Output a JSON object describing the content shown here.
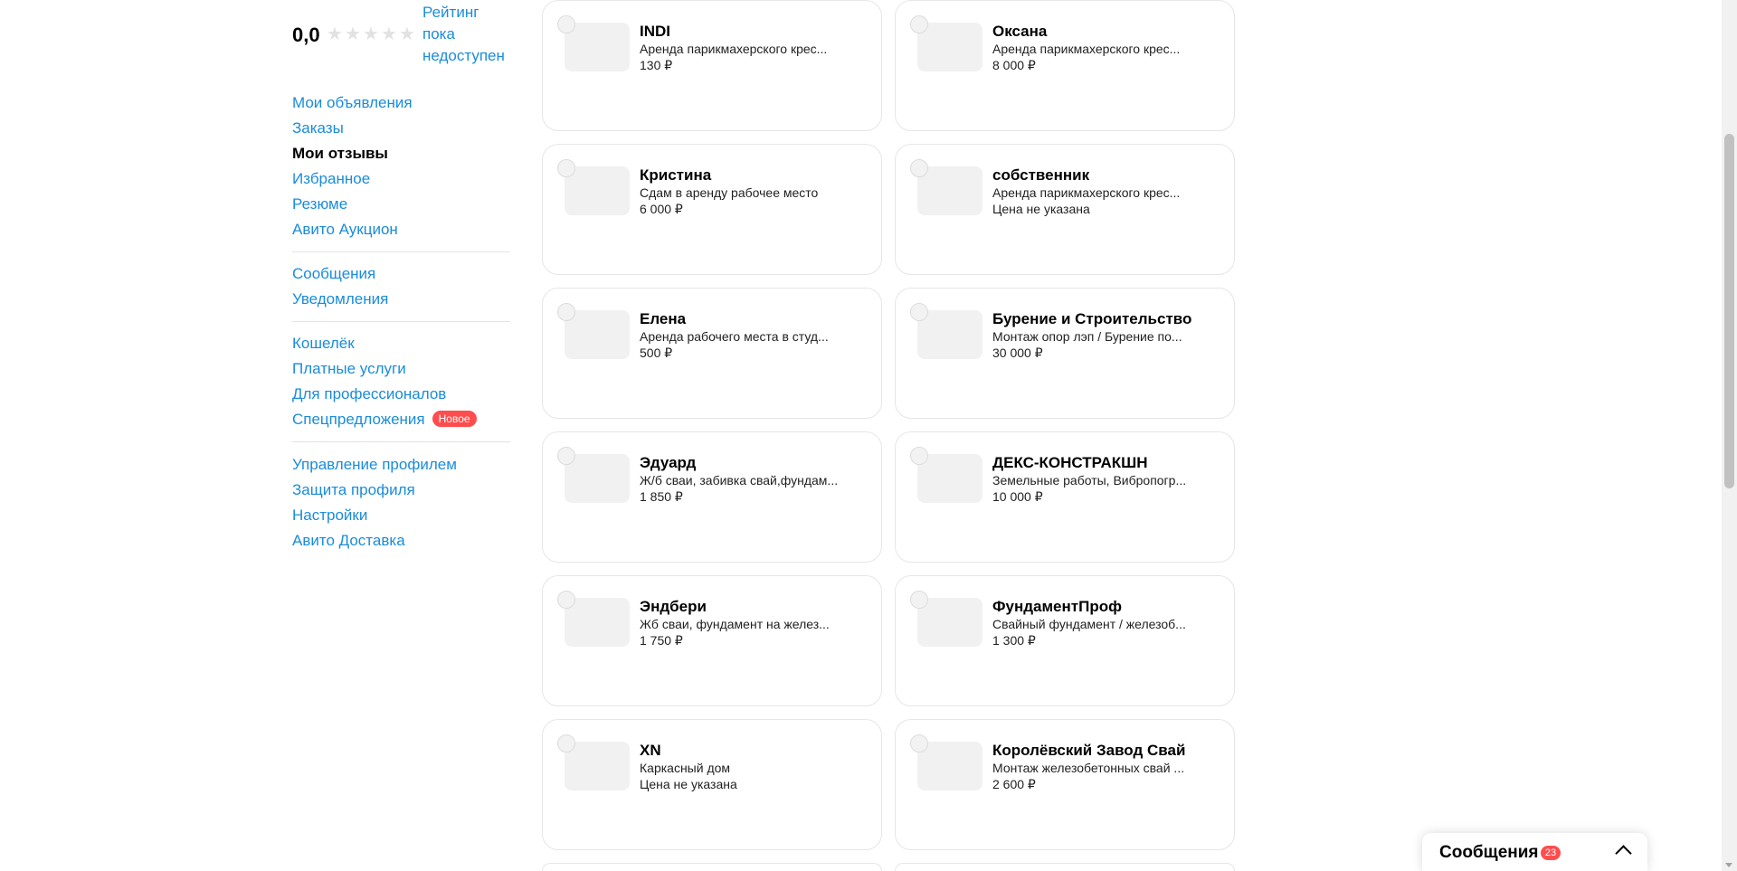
{
  "rating": {
    "value": "0,0",
    "note": "Рейтинг пока недоступен",
    "stars_filled": 0,
    "stars_total": 5
  },
  "sidebar": {
    "group1": [
      "Мои объявления",
      "Заказы",
      "Мои отзывы",
      "Избранное",
      "Резюме",
      "Авито Аукцион"
    ],
    "group2": [
      "Сообщения",
      "Уведомления"
    ],
    "group3": [
      "Кошелёк",
      "Платные услуги",
      "Для профессионалов",
      "Спецпредложения"
    ],
    "new_badge": "Новое",
    "group4": [
      "Управление профилем",
      "Защита профиля",
      "Настройки",
      "Авито Доставка"
    ],
    "active_item": "Мои отзывы"
  },
  "cards": [
    {
      "name": "INDI",
      "desc": "Аренда парикмахерского крес...",
      "price": "130 ₽"
    },
    {
      "name": "Оксана",
      "desc": "Аренда парикмахерского крес...",
      "price": "8 000 ₽"
    },
    {
      "name": "Кристина",
      "desc": "Сдам в аренду рабочее место",
      "price": "6 000 ₽"
    },
    {
      "name": "собственник",
      "desc": "Аренда парикмахерского крес...",
      "price": "Цена не указана"
    },
    {
      "name": "Елена",
      "desc": "Аренда рабочего места в студ...",
      "price": "500 ₽"
    },
    {
      "name": "Бурение и Строительство",
      "desc": "Монтаж опор лэп / Бурение по...",
      "price": "30 000 ₽"
    },
    {
      "name": "Эдуард",
      "desc": "Ж/б сваи, забивка свай,фундам...",
      "price": "1 850 ₽"
    },
    {
      "name": "ДЕКС-КОНСТРАКШН",
      "desc": "Земельные работы, Вибропогр...",
      "price": "10 000 ₽"
    },
    {
      "name": "Эндбери",
      "desc": "Жб сваи, фундамент на желез...",
      "price": "1 750 ₽"
    },
    {
      "name": "ФундаментПроф",
      "desc": "Свайный фундамент / железоб...",
      "price": "1 300 ₽"
    },
    {
      "name": "XN",
      "desc": "Каркасный дом",
      "price": "Цена не указана"
    },
    {
      "name": "Королёвский Завод Свай",
      "desc": "Монтаж железобетонных свай ...",
      "price": "2 600 ₽"
    }
  ],
  "messages_panel": {
    "label": "Сообщения",
    "count": "23"
  },
  "colors": {
    "link": "#1a8cdb",
    "badge": "#ff4d4d"
  }
}
